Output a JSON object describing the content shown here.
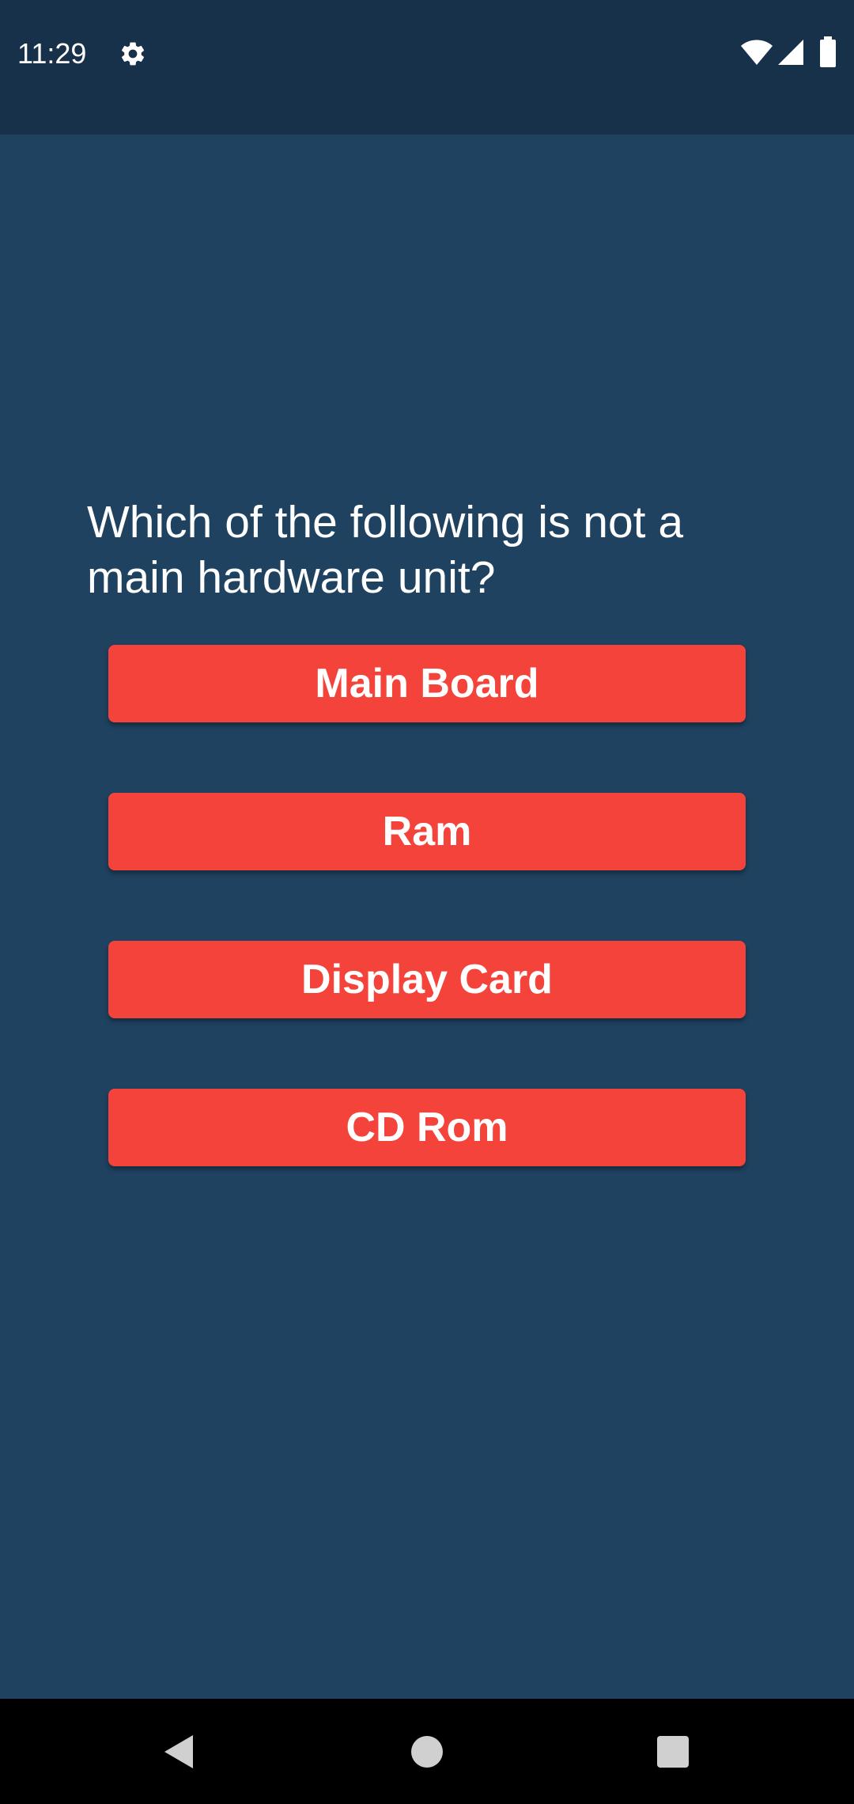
{
  "status_bar": {
    "time": "11:29",
    "icons": [
      "settings-gear-icon",
      "wifi-icon",
      "cellular-signal-icon",
      "battery-icon"
    ],
    "background_color": "#18314a"
  },
  "quiz": {
    "question": "Which of the following is not a main hardware unit?",
    "answers": [
      "Main Board",
      "Ram",
      "Display Card",
      "CD Rom"
    ],
    "background_color": "#1f4260",
    "button_color": "#f4433a"
  },
  "nav_bar": {
    "icons": [
      "back-icon",
      "home-icon",
      "recents-icon"
    ],
    "background_color": "#000000"
  }
}
